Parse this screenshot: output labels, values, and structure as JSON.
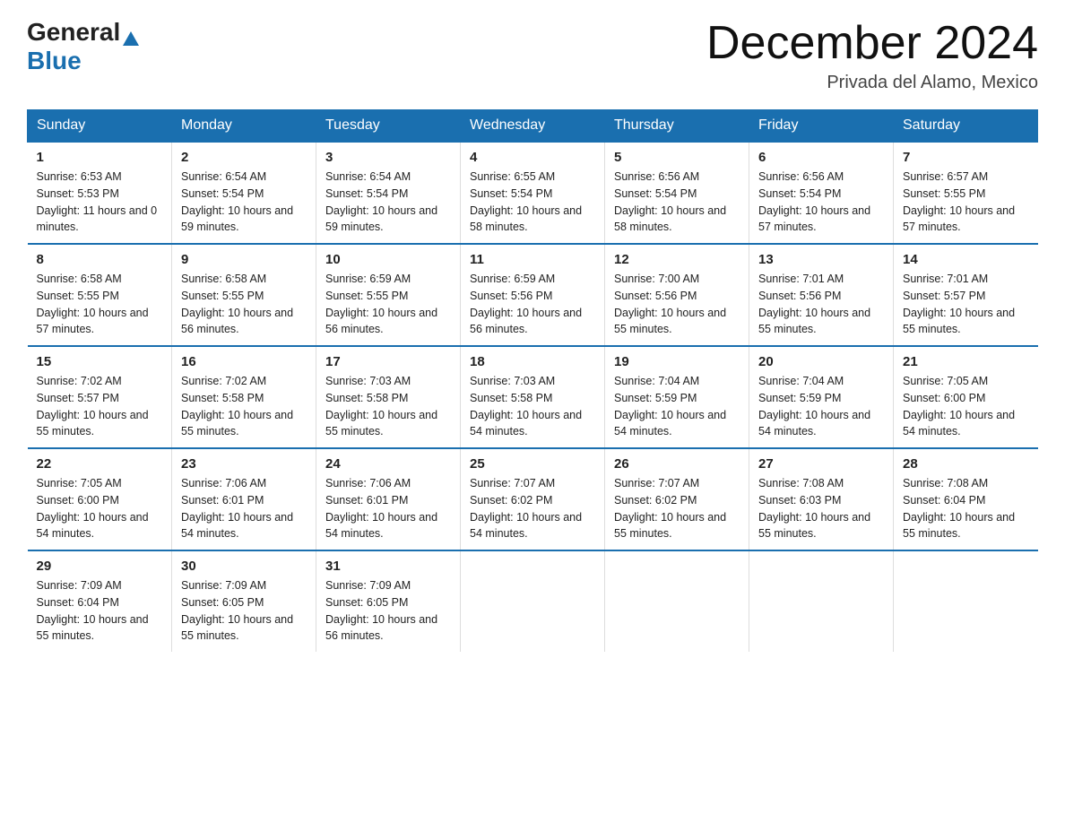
{
  "header": {
    "logo_general": "General",
    "logo_blue": "Blue",
    "month_title": "December 2024",
    "location": "Privada del Alamo, Mexico"
  },
  "days_of_week": [
    "Sunday",
    "Monday",
    "Tuesday",
    "Wednesday",
    "Thursday",
    "Friday",
    "Saturday"
  ],
  "weeks": [
    [
      {
        "day": "1",
        "sunrise": "6:53 AM",
        "sunset": "5:53 PM",
        "daylight": "11 hours and 0 minutes."
      },
      {
        "day": "2",
        "sunrise": "6:54 AM",
        "sunset": "5:54 PM",
        "daylight": "10 hours and 59 minutes."
      },
      {
        "day": "3",
        "sunrise": "6:54 AM",
        "sunset": "5:54 PM",
        "daylight": "10 hours and 59 minutes."
      },
      {
        "day": "4",
        "sunrise": "6:55 AM",
        "sunset": "5:54 PM",
        "daylight": "10 hours and 58 minutes."
      },
      {
        "day": "5",
        "sunrise": "6:56 AM",
        "sunset": "5:54 PM",
        "daylight": "10 hours and 58 minutes."
      },
      {
        "day": "6",
        "sunrise": "6:56 AM",
        "sunset": "5:54 PM",
        "daylight": "10 hours and 57 minutes."
      },
      {
        "day": "7",
        "sunrise": "6:57 AM",
        "sunset": "5:55 PM",
        "daylight": "10 hours and 57 minutes."
      }
    ],
    [
      {
        "day": "8",
        "sunrise": "6:58 AM",
        "sunset": "5:55 PM",
        "daylight": "10 hours and 57 minutes."
      },
      {
        "day": "9",
        "sunrise": "6:58 AM",
        "sunset": "5:55 PM",
        "daylight": "10 hours and 56 minutes."
      },
      {
        "day": "10",
        "sunrise": "6:59 AM",
        "sunset": "5:55 PM",
        "daylight": "10 hours and 56 minutes."
      },
      {
        "day": "11",
        "sunrise": "6:59 AM",
        "sunset": "5:56 PM",
        "daylight": "10 hours and 56 minutes."
      },
      {
        "day": "12",
        "sunrise": "7:00 AM",
        "sunset": "5:56 PM",
        "daylight": "10 hours and 55 minutes."
      },
      {
        "day": "13",
        "sunrise": "7:01 AM",
        "sunset": "5:56 PM",
        "daylight": "10 hours and 55 minutes."
      },
      {
        "day": "14",
        "sunrise": "7:01 AM",
        "sunset": "5:57 PM",
        "daylight": "10 hours and 55 minutes."
      }
    ],
    [
      {
        "day": "15",
        "sunrise": "7:02 AM",
        "sunset": "5:57 PM",
        "daylight": "10 hours and 55 minutes."
      },
      {
        "day": "16",
        "sunrise": "7:02 AM",
        "sunset": "5:58 PM",
        "daylight": "10 hours and 55 minutes."
      },
      {
        "day": "17",
        "sunrise": "7:03 AM",
        "sunset": "5:58 PM",
        "daylight": "10 hours and 55 minutes."
      },
      {
        "day": "18",
        "sunrise": "7:03 AM",
        "sunset": "5:58 PM",
        "daylight": "10 hours and 54 minutes."
      },
      {
        "day": "19",
        "sunrise": "7:04 AM",
        "sunset": "5:59 PM",
        "daylight": "10 hours and 54 minutes."
      },
      {
        "day": "20",
        "sunrise": "7:04 AM",
        "sunset": "5:59 PM",
        "daylight": "10 hours and 54 minutes."
      },
      {
        "day": "21",
        "sunrise": "7:05 AM",
        "sunset": "6:00 PM",
        "daylight": "10 hours and 54 minutes."
      }
    ],
    [
      {
        "day": "22",
        "sunrise": "7:05 AM",
        "sunset": "6:00 PM",
        "daylight": "10 hours and 54 minutes."
      },
      {
        "day": "23",
        "sunrise": "7:06 AM",
        "sunset": "6:01 PM",
        "daylight": "10 hours and 54 minutes."
      },
      {
        "day": "24",
        "sunrise": "7:06 AM",
        "sunset": "6:01 PM",
        "daylight": "10 hours and 54 minutes."
      },
      {
        "day": "25",
        "sunrise": "7:07 AM",
        "sunset": "6:02 PM",
        "daylight": "10 hours and 54 minutes."
      },
      {
        "day": "26",
        "sunrise": "7:07 AM",
        "sunset": "6:02 PM",
        "daylight": "10 hours and 55 minutes."
      },
      {
        "day": "27",
        "sunrise": "7:08 AM",
        "sunset": "6:03 PM",
        "daylight": "10 hours and 55 minutes."
      },
      {
        "day": "28",
        "sunrise": "7:08 AM",
        "sunset": "6:04 PM",
        "daylight": "10 hours and 55 minutes."
      }
    ],
    [
      {
        "day": "29",
        "sunrise": "7:09 AM",
        "sunset": "6:04 PM",
        "daylight": "10 hours and 55 minutes."
      },
      {
        "day": "30",
        "sunrise": "7:09 AM",
        "sunset": "6:05 PM",
        "daylight": "10 hours and 55 minutes."
      },
      {
        "day": "31",
        "sunrise": "7:09 AM",
        "sunset": "6:05 PM",
        "daylight": "10 hours and 56 minutes."
      },
      null,
      null,
      null,
      null
    ]
  ]
}
